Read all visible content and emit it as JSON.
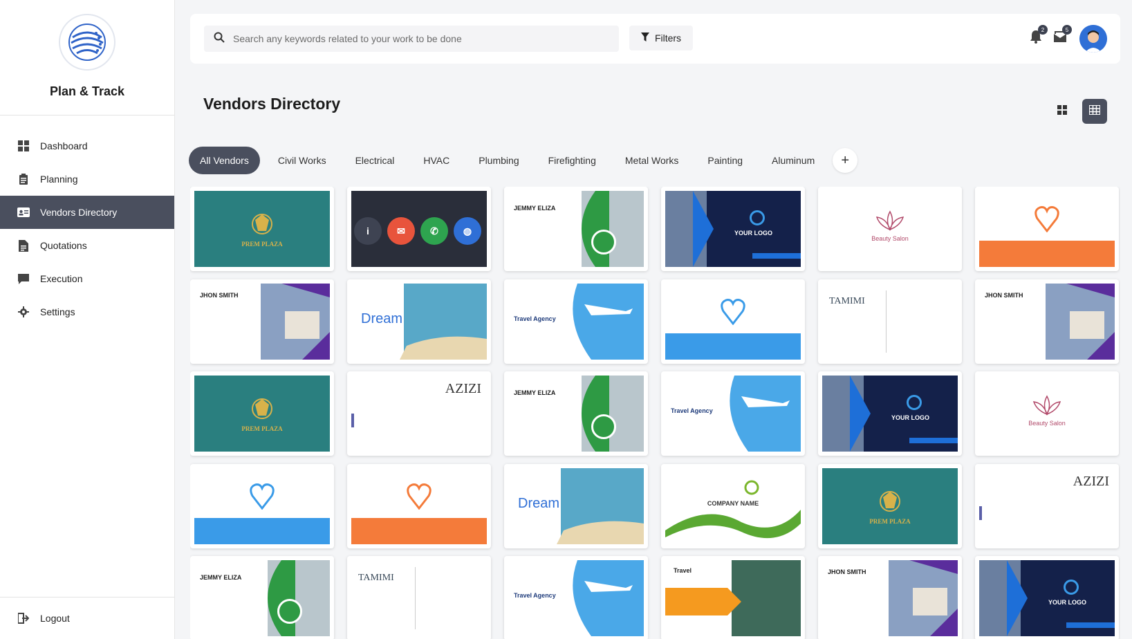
{
  "app": {
    "name": "Plan & Track"
  },
  "sidebar": {
    "items": [
      {
        "label": "Dashboard",
        "icon": "dashboard-icon",
        "active": false
      },
      {
        "label": "Planning",
        "icon": "clipboard-icon",
        "active": false
      },
      {
        "label": "Vendors Directory",
        "icon": "id-card-icon",
        "active": true
      },
      {
        "label": "Quotations",
        "icon": "document-icon",
        "active": false
      },
      {
        "label": "Execution",
        "icon": "chat-icon",
        "active": false
      },
      {
        "label": "Settings",
        "icon": "gear-icon",
        "active": false
      }
    ],
    "logout_label": "Logout"
  },
  "topbar": {
    "search_placeholder": "Search any keywords related to your work to be done",
    "filters_label": "Filters",
    "notifications_count": "2",
    "messages_count": "5"
  },
  "main": {
    "title": "Vendors Directory",
    "categories": [
      "All Vendors",
      "Civil Works",
      "Electrical",
      "HVAC",
      "Plumbing",
      "Firefighting",
      "Metal Works",
      "Painting",
      "Aluminum"
    ]
  },
  "cards": [
    {
      "kind": "prem",
      "text": "PREM PLAZA"
    },
    {
      "kind": "actions",
      "text": ""
    },
    {
      "kind": "jemmy",
      "text": "JEMMY ELIZA"
    },
    {
      "kind": "yourlogo",
      "text": "YOUR LOGO"
    },
    {
      "kind": "beauty",
      "text": "Beauty Salon"
    },
    {
      "kind": "heart-orange",
      "text": ""
    },
    {
      "kind": "jhon",
      "text": "JHON SMITH"
    },
    {
      "kind": "dream",
      "text": "Dream"
    },
    {
      "kind": "travel",
      "text": "Travel Agency"
    },
    {
      "kind": "heart-blue",
      "text": ""
    },
    {
      "kind": "tamimi",
      "text": "TAMIMI"
    },
    {
      "kind": "jhon",
      "text": "JHON SMITH"
    },
    {
      "kind": "prem",
      "text": "PREM PLAZA"
    },
    {
      "kind": "azizi",
      "text": "AZIZI"
    },
    {
      "kind": "jemmy",
      "text": "JEMMY ELIZA"
    },
    {
      "kind": "travel",
      "text": "Travel Agency"
    },
    {
      "kind": "yourlogo",
      "text": "YOUR LOGO"
    },
    {
      "kind": "beauty",
      "text": "Beauty Salon"
    },
    {
      "kind": "heart-blue",
      "text": ""
    },
    {
      "kind": "heart-orange",
      "text": ""
    },
    {
      "kind": "dream",
      "text": "Dream"
    },
    {
      "kind": "company",
      "text": "COMPANY NAME"
    },
    {
      "kind": "prem",
      "text": "PREM PLAZA"
    },
    {
      "kind": "azizi",
      "text": "AZIZI"
    },
    {
      "kind": "jemmy",
      "text": "JEMMY ELIZA"
    },
    {
      "kind": "tamimi",
      "text": "TAMIMI"
    },
    {
      "kind": "travel",
      "text": "Travel Agency"
    },
    {
      "kind": "mark",
      "text": "Travel"
    },
    {
      "kind": "jhon",
      "text": "JHON SMITH"
    },
    {
      "kind": "yourlogo",
      "text": "YOUR LOGO"
    }
  ],
  "colors": {
    "accent": "#4a4f5e",
    "teal": "#2a7f7f",
    "navy": "#14214a",
    "orange": "#f47b3a",
    "blue": "#3a9be8"
  }
}
